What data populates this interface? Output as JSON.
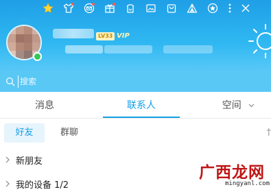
{
  "toolbar": {
    "icons": [
      "star-icon",
      "shirt-icon",
      "mail-icon",
      "gift-icon",
      "clothes-hanger-icon",
      "image-icon",
      "bag-icon",
      "tent-icon",
      "qzone-icon",
      "more-vertical-icon",
      "close-icon"
    ]
  },
  "profile": {
    "level": "LV33",
    "vip": "VIP",
    "status": "online"
  },
  "search": {
    "placeholder": "搜索"
  },
  "tabs": {
    "messages": "消息",
    "contacts": "联系人",
    "space": "空间"
  },
  "subtabs": {
    "friends": "好友",
    "groups": "群聊",
    "more": "†"
  },
  "list": [
    {
      "label": "新朋友"
    },
    {
      "label": "我的设备 1/2"
    }
  ],
  "watermark": {
    "text": "广西龙网",
    "url": "mingyanl.com"
  },
  "colors": {
    "header_top": "#1f9fe6",
    "header_bottom": "#3cc0f5",
    "accent": "#15a1e6",
    "online": "#34c759"
  }
}
